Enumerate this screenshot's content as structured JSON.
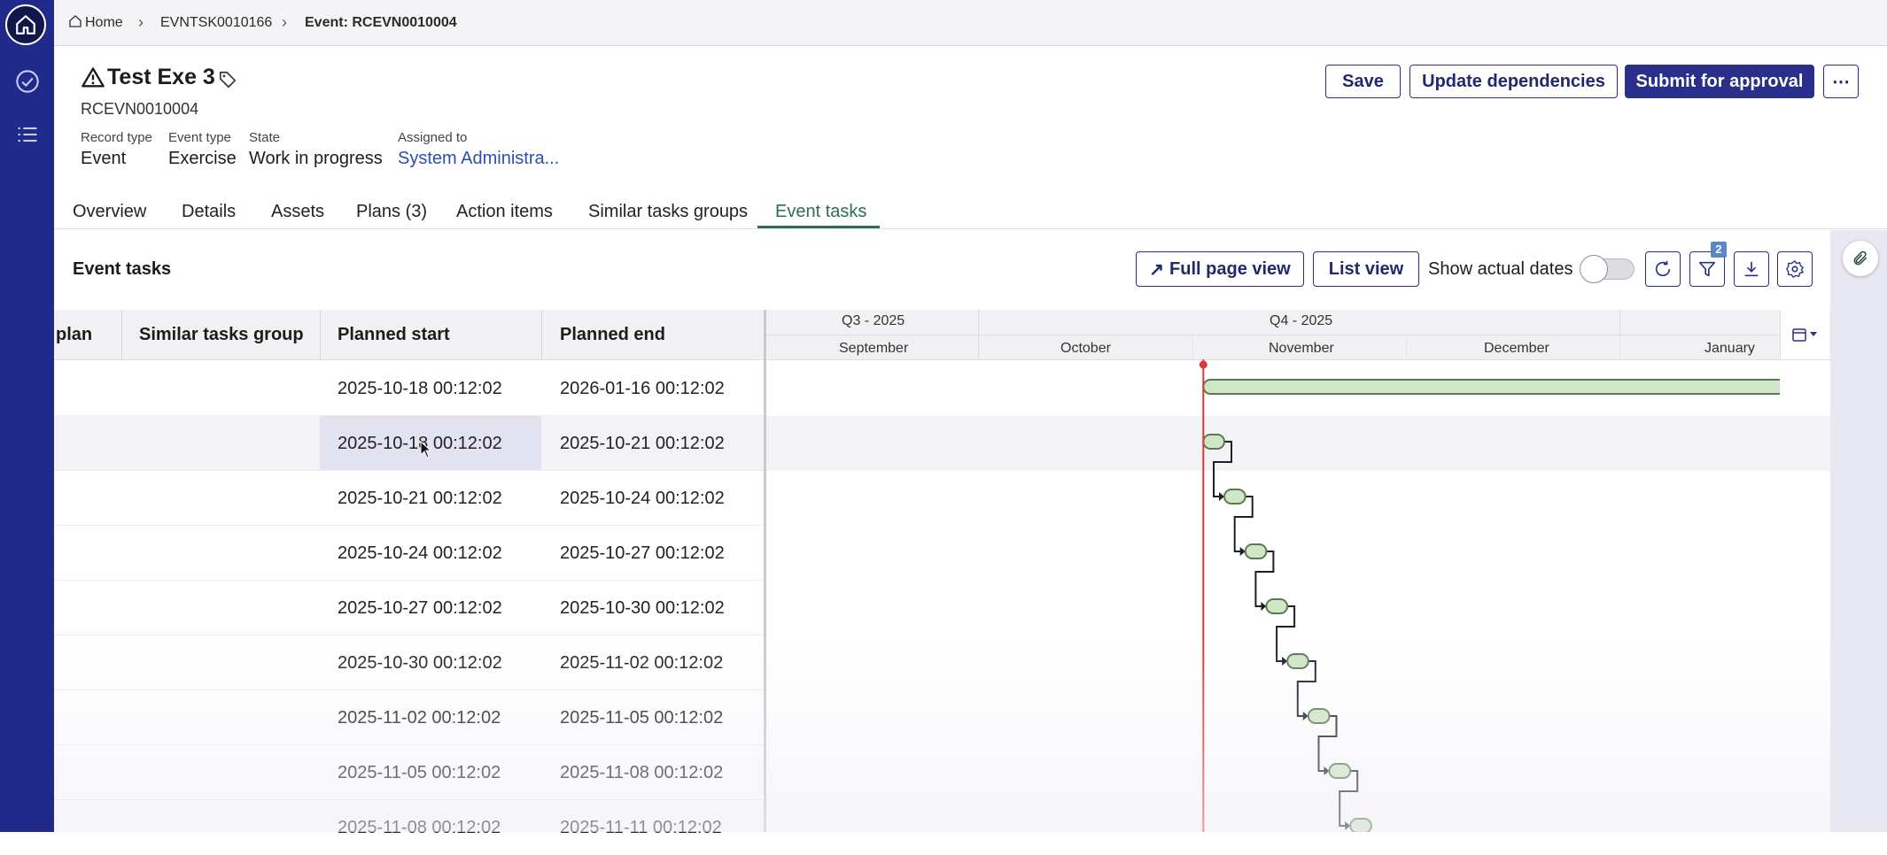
{
  "breadcrumb": {
    "items": [
      "Home",
      "EVNTSK0010166",
      "Event: RCEVN0010004"
    ]
  },
  "header": {
    "title": "Test Exe 3",
    "record_id": "RCEVN0010004",
    "meta": [
      {
        "label": "Record type",
        "value": "Event"
      },
      {
        "label": "Event type",
        "value": "Exercise"
      },
      {
        "label": "State",
        "value": "Work in progress"
      },
      {
        "label": "Assigned to",
        "value": "System Administra..."
      }
    ],
    "buttons": {
      "save": "Save",
      "update": "Update dependencies",
      "submit": "Submit for approval",
      "more": "⋯"
    }
  },
  "tabs": [
    {
      "label": "Overview"
    },
    {
      "label": "Details"
    },
    {
      "label": "Assets"
    },
    {
      "label": "Plans (3)"
    },
    {
      "label": "Action items"
    },
    {
      "label": "Similar tasks groups"
    },
    {
      "label": "Event tasks",
      "active": true
    }
  ],
  "section": {
    "title": "Event tasks",
    "full_page_label": "Full page view",
    "list_view_label": "List view",
    "show_actual_dates_label": "Show actual dates",
    "show_actual_dates_on": false,
    "filter_count": "2"
  },
  "table": {
    "columns": [
      "plan",
      "Similar tasks group",
      "Planned start",
      "Planned end"
    ],
    "rows": [
      {
        "start": "2025-10-18 00:12:02",
        "end": "2026-01-16 00:12:02"
      },
      {
        "start": "2025-10-18 00:12:02",
        "end": "2025-10-21 00:12:02"
      },
      {
        "start": "2025-10-21 00:12:02",
        "end": "2025-10-24 00:12:02"
      },
      {
        "start": "2025-10-24 00:12:02",
        "end": "2025-10-27 00:12:02"
      },
      {
        "start": "2025-10-27 00:12:02",
        "end": "2025-10-30 00:12:02"
      },
      {
        "start": "2025-10-30 00:12:02",
        "end": "2025-11-02 00:12:02"
      },
      {
        "start": "2025-11-02 00:12:02",
        "end": "2025-11-05 00:12:02"
      },
      {
        "start": "2025-11-05 00:12:02",
        "end": "2025-11-08 00:12:02"
      },
      {
        "start": "2025-11-08 00:12:02",
        "end": "2025-11-11 00:12:02"
      }
    ]
  },
  "gantt": {
    "quarters": [
      "Q3 - 2025",
      "Q4 - 2025"
    ],
    "months": [
      "September",
      "October",
      "November",
      "December",
      "January"
    ],
    "today": "2025-10-18"
  },
  "colors": {
    "brand": "#2a2f8c",
    "rail": "#1f2a8a",
    "bar_fill": "#cfe6c7",
    "bar_stroke": "#5b7a4e",
    "today_line": "#d83a3a",
    "active_tab": "#2e6b5e"
  }
}
